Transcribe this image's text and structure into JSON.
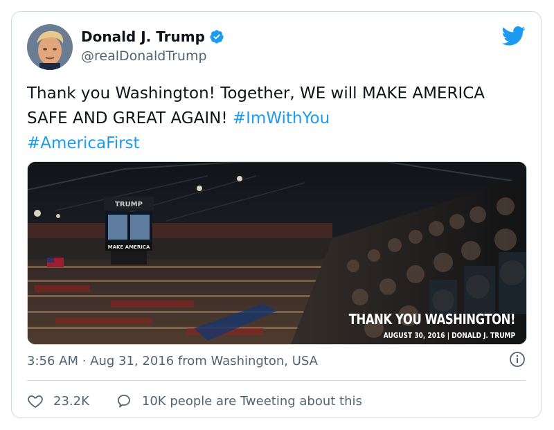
{
  "author": {
    "name": "Donald J. Trump",
    "handle": "@realDonaldTrump",
    "verified": true
  },
  "tweet": {
    "text_plain": "Thank you Washington! Together, WE will MAKE AMERICA SAFE AND GREAT AGAIN!",
    "hashtags": [
      "#ImWithYou",
      "#AmericaFirst"
    ]
  },
  "media": {
    "overlay_title": "THANK YOU WASHINGTON!",
    "overlay_subtitle": "AUGUST 30, 2016 | DONALD J. TRUMP",
    "scoreboard_text": "TRUMP",
    "screen_text": "MAKE AMERICA"
  },
  "meta": {
    "timestamp": "3:56 AM · Aug 31, 2016 from Washington, USA"
  },
  "actions": {
    "likes": "23.2K",
    "replies_text": "10K people are Tweeting about this"
  },
  "icons": {
    "bird": "twitter-bird-icon",
    "verified": "verified-badge-icon",
    "info": "info-icon",
    "heart": "heart-icon",
    "reply": "reply-bubble-icon"
  },
  "colors": {
    "accent": "#1d9bf0",
    "text": "#0f1419",
    "muted": "#536471",
    "border": "#cfd9de"
  }
}
